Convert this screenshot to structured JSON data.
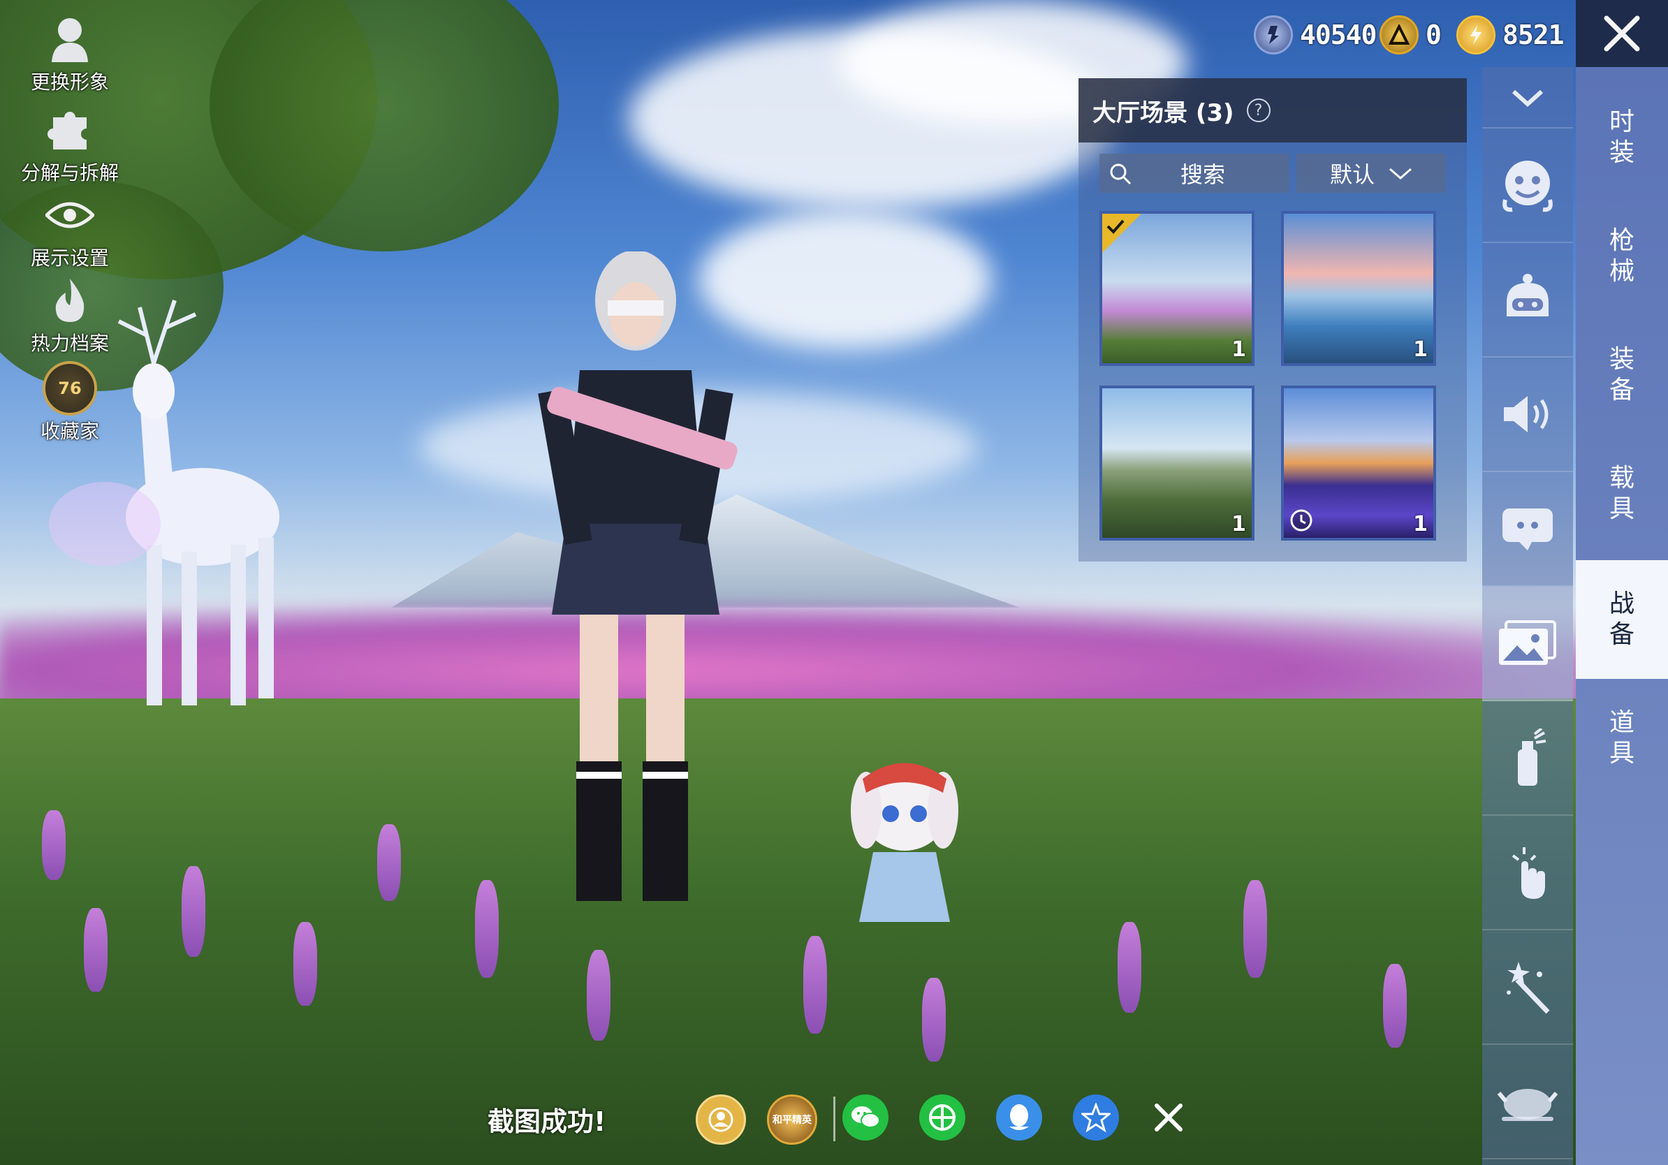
{
  "left_menu": [
    {
      "label": "更换形象",
      "icon": "avatar-icon"
    },
    {
      "label": "分解与拆解",
      "icon": "puzzle-icon"
    },
    {
      "label": "展示设置",
      "icon": "eye-icon"
    },
    {
      "label": "热力档案",
      "icon": "flame-icon"
    },
    {
      "label": "收藏家",
      "icon": "collector-badge-icon",
      "badge_number": "76"
    }
  ],
  "currency": [
    {
      "value": "40540",
      "icon": "silver-coin-icon",
      "color": "#6c8ad0"
    },
    {
      "value": "0",
      "icon": "gold-token-icon",
      "color": "#d6a21e"
    },
    {
      "value": "8521",
      "icon": "lightning-coin-icon",
      "color": "#f2b91f"
    }
  ],
  "panel": {
    "title": "大厅场景 (3)",
    "search_label": "搜索",
    "sort_label": "默认",
    "items": [
      {
        "count": "1",
        "selected": true,
        "timed": false,
        "theme": "lavender-field"
      },
      {
        "count": "1",
        "selected": false,
        "timed": false,
        "theme": "sea-sunset"
      },
      {
        "count": "1",
        "selected": false,
        "timed": false,
        "theme": "mountain-valley"
      },
      {
        "count": "1",
        "selected": false,
        "timed": true,
        "theme": "neon-plaza"
      }
    ]
  },
  "right_tabs": [
    {
      "label": "时装",
      "active": false
    },
    {
      "label": "枪械",
      "active": false
    },
    {
      "label": "装备",
      "active": false
    },
    {
      "label": "载具",
      "active": false
    },
    {
      "label": "战备",
      "active": true
    },
    {
      "label": "道具",
      "active": false
    }
  ],
  "icon_column": [
    "face-emote-icon",
    "robot-helmet-icon",
    "speaker-icon",
    "chat-bubble-icon",
    "gallery-icon",
    "spray-can-icon",
    "tap-gesture-icon",
    "magic-wand-icon",
    "roast-chicken-icon"
  ],
  "share_bar": {
    "message": "截图成功!",
    "buttons": [
      {
        "icon": "profile-share-icon",
        "color": "#e0b040"
      },
      {
        "icon": "game-logo-icon",
        "color": "#c9952a",
        "text": "和平精英"
      },
      {
        "icon": "wechat-icon",
        "color": "#23c043"
      },
      {
        "icon": "moments-icon",
        "color": "#23c043"
      },
      {
        "icon": "qq-icon",
        "color": "#3a8fe8"
      },
      {
        "icon": "qzone-icon",
        "color": "#2f7de0"
      },
      {
        "icon": "close-share-icon",
        "color": "#1e2b4a"
      }
    ]
  }
}
